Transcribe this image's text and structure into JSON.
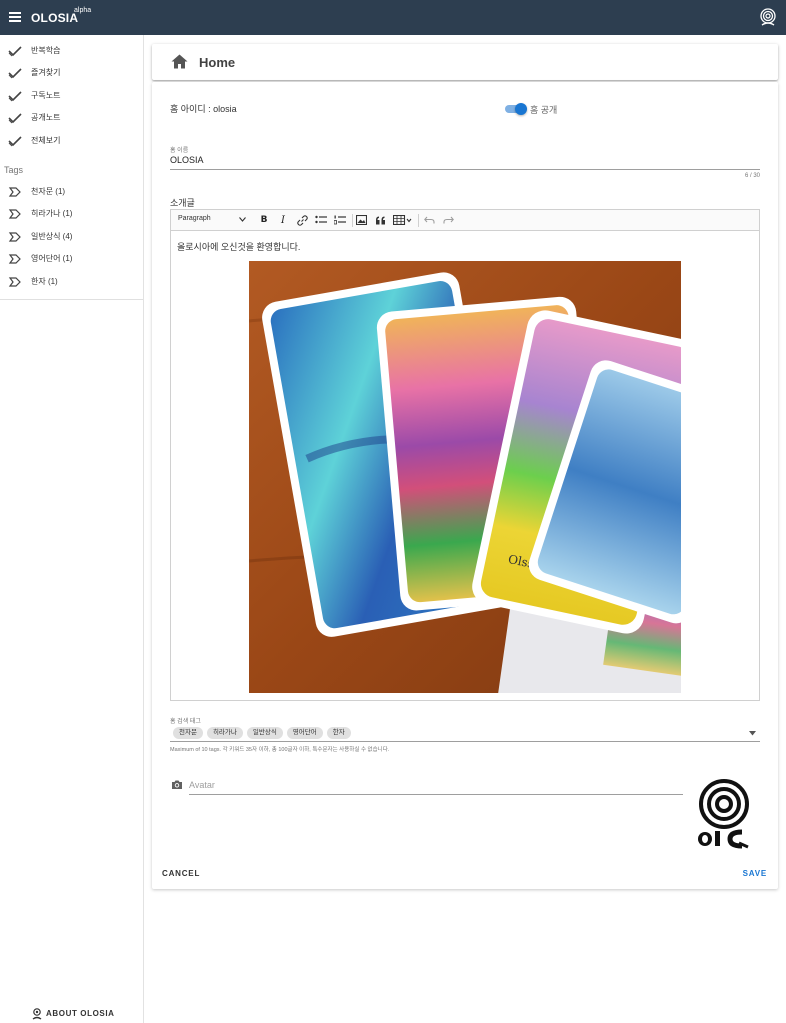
{
  "appbar": {
    "brand": "OLOSIA",
    "brand_badge": "alpha",
    "icons": [
      "menu-icon",
      "profile-logo-icon"
    ]
  },
  "sidebar": {
    "items": [
      {
        "label": "반복학습",
        "icon": "check-icon"
      },
      {
        "label": "즐겨찾기",
        "icon": "check-icon"
      },
      {
        "label": "구독노트",
        "icon": "check-icon"
      },
      {
        "label": "공개노트",
        "icon": "check-icon"
      },
      {
        "label": "전체보기",
        "icon": "check-icon"
      }
    ],
    "tags_heading": "Tags",
    "tags": [
      {
        "label": "천자문 (1)",
        "icon": "tag-icon"
      },
      {
        "label": "히라가나 (1)",
        "icon": "tag-icon"
      },
      {
        "label": "일반상식 (4)",
        "icon": "tag-icon"
      },
      {
        "label": "영어단어 (1)",
        "icon": "tag-icon"
      },
      {
        "label": "한자 (1)",
        "icon": "tag-icon"
      }
    ],
    "about_label": "ABOUT OLOSIA"
  },
  "header": {
    "title": "Home",
    "icon": "home-icon"
  },
  "form": {
    "home_id": "홈 아이디 : olosia",
    "public_toggle": {
      "label": "홈 공개",
      "on": true
    },
    "home_name": {
      "label": "홈 이름",
      "value": "OLOSIA",
      "counter": "6 / 30"
    },
    "intro": {
      "label": "소개글",
      "toolbar": {
        "paragraph": "Paragraph",
        "bold": "B",
        "italic": "I",
        "icons": [
          "link-icon",
          "bulleted-list-icon",
          "numbered-list-icon",
          "image-icon",
          "quote-icon",
          "table-icon",
          "undo-icon",
          "redo-icon"
        ]
      },
      "text": "올로시아에 오신것을 환영합니다."
    },
    "search_tags": {
      "label": "홈 검색 태그",
      "chips": [
        "천자문",
        "히라가나",
        "일반상식",
        "영어단어",
        "한자"
      ],
      "hint": "Maximum of 10 tags. 각 키워드 35자 이하, 총 100글자 이하, 특수문자는 사용하실 수 없습니다."
    },
    "avatar": {
      "placeholder": "Avatar",
      "icon": "camera-icon"
    },
    "cancel_label": "CANCEL",
    "save_label": "SAVE"
  },
  "colors": {
    "appbar": "#2d3e50",
    "accent": "#1976d2",
    "toggle_track": "#7fb0e3"
  }
}
